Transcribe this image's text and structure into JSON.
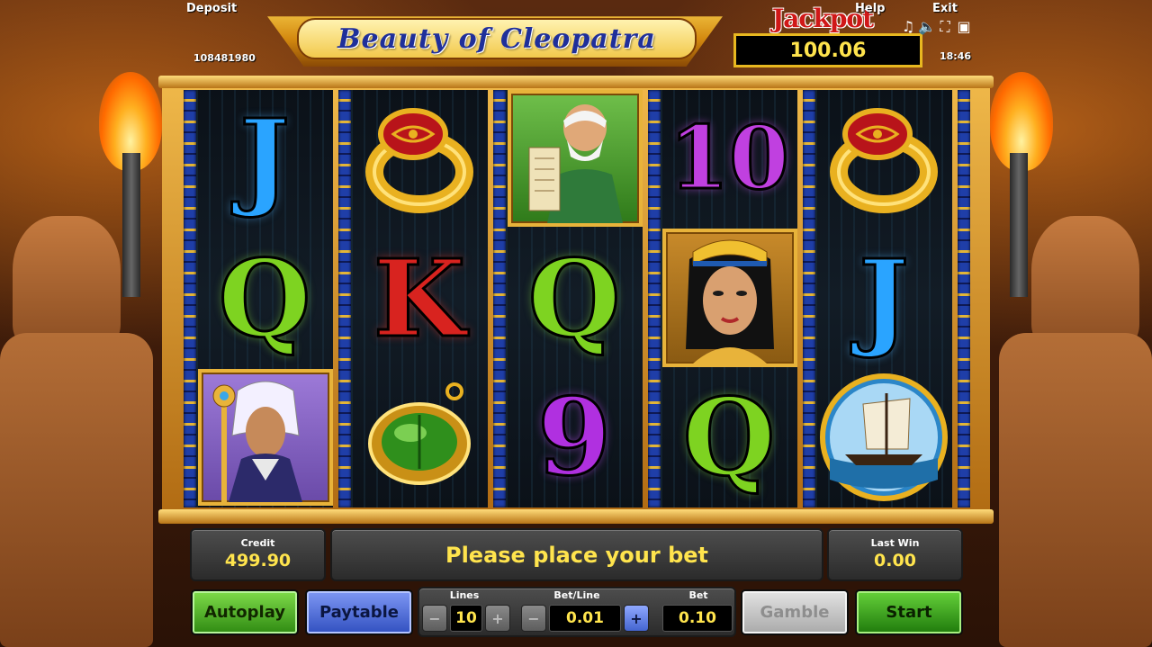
{
  "header": {
    "deposit_label": "Deposit",
    "deposit_value": "108481980",
    "logo_text": "Beauty of Cleopatra",
    "jackpot_label": "Jackpot",
    "jackpot_value": "100.06",
    "help_label": "Help",
    "exit_label": "Exit",
    "time": "18:46",
    "icons": [
      "music-icon",
      "sound-icon",
      "fullscreen-icon",
      "settings-icon"
    ]
  },
  "reels": [
    [
      "J",
      "Q",
      "pharaoh"
    ],
    [
      "ring",
      "K",
      "scarab"
    ],
    [
      "scribe",
      "Q",
      "9"
    ],
    [
      "10",
      "cleopatra",
      "Q"
    ],
    [
      "ring",
      "J",
      "ship"
    ]
  ],
  "panel": {
    "credit_label": "Credit",
    "credit_value": "499.90",
    "message": "Please place your bet",
    "last_win_label": "Last Win",
    "last_win_value": "0.00"
  },
  "controls": {
    "autoplay_label": "Autoplay",
    "paytable_label": "Paytable",
    "lines_label": "Lines",
    "lines_value": "10",
    "bet_line_label": "Bet/Line",
    "bet_line_value": "0.01",
    "bet_label": "Bet",
    "bet_value": "0.10",
    "gamble_label": "Gamble",
    "start_label": "Start",
    "minus": "−",
    "plus": "+"
  }
}
